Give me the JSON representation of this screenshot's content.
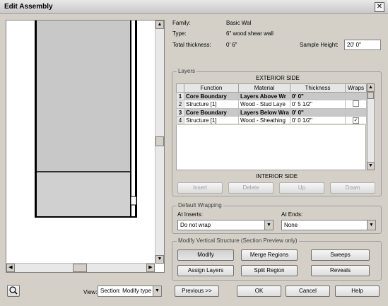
{
  "dialog": {
    "title": "Edit Assembly",
    "close_glyph": "✕"
  },
  "properties": {
    "family_label": "Family:",
    "family_value": "Basic Wal",
    "type_label": "Type:",
    "type_value": "6\" wood shear wall",
    "thickness_label": "Total thickness:",
    "thickness_value": "0'  6\"",
    "sample_height_label": "Sample Height:",
    "sample_height_value": "20'  0\""
  },
  "layers": {
    "legend": "Layers",
    "exterior_label": "EXTERIOR SIDE",
    "interior_label": "INTERIOR SIDE",
    "headers": [
      "",
      "Function",
      "Material",
      "Thickness",
      "Wraps"
    ],
    "rows": [
      {
        "num": "1",
        "function": "Core Boundary",
        "material": "Layers Above Wr",
        "thickness": "0'  0\"",
        "wraps": "",
        "bold": true
      },
      {
        "num": "2",
        "function": "Structure [1]",
        "material": "Wood - Stud Laye",
        "thickness": "0'  5 1/2\"",
        "wraps": "",
        "bold": false
      },
      {
        "num": "3",
        "function": "Core Boundary",
        "material": "Layers Below Wra",
        "thickness": "0'  0\"",
        "wraps": "",
        "bold": true
      },
      {
        "num": "4",
        "function": "Structure [1]",
        "material": "Wood - Sheathing",
        "thickness": "0'  0 1/2\"",
        "wraps": "✓",
        "bold": false
      }
    ],
    "buttons": {
      "insert": "Insert",
      "delete": "Delete",
      "up": "Up",
      "down": "Down"
    }
  },
  "wrapping": {
    "legend": "Default Wrapping",
    "at_inserts_label": "At Inserts:",
    "at_inserts_value": "Do not wrap",
    "at_ends_label": "At Ends:",
    "at_ends_value": "None"
  },
  "vertical": {
    "legend": "Modify Vertical Structure (Section Preview only)",
    "modify": "Modify",
    "merge": "Merge Regions",
    "sweeps": "Sweeps",
    "assign": "Assign Layers",
    "split": "Split Region",
    "reveals": "Reveals"
  },
  "footer": {
    "view_label": "View:",
    "view_value": "Section: Modify type",
    "previous": "Previous >>",
    "ok": "OK",
    "cancel": "Cancel",
    "help": "Help"
  },
  "icons": {
    "scroll_up": "▲",
    "scroll_down": "▼",
    "scroll_left": "◀",
    "scroll_right": "▶",
    "dropdown": "▼"
  }
}
